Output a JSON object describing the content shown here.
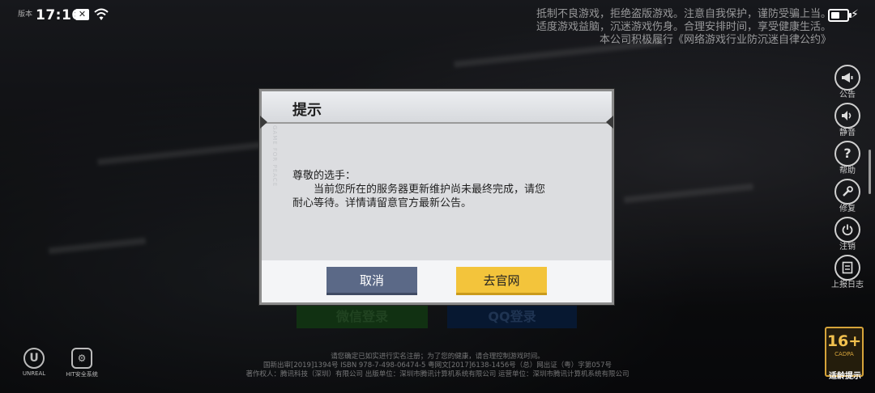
{
  "status_bar": {
    "version": "版本",
    "time": "17:16",
    "battery_level": 0.55
  },
  "notice": {
    "line1": "抵制不良游戏，拒绝盗版游戏。注意自我保护，谨防受骗上当。",
    "line2": "适度游戏益脑，沉迷游戏伤身。合理安排时间，享受健康生活。",
    "line3": "本公司积极履行《网络游戏行业防沉迷自律公约》"
  },
  "toolbar": {
    "items": [
      {
        "label": "公告",
        "icon": "megaphone-icon"
      },
      {
        "label": "静音",
        "icon": "speaker-icon"
      },
      {
        "label": "帮助",
        "icon": "help-icon"
      },
      {
        "label": "修复",
        "icon": "wrench-icon"
      },
      {
        "label": "注销",
        "icon": "power-icon"
      },
      {
        "label": "上报日志",
        "icon": "log-icon"
      }
    ]
  },
  "login": {
    "wechat_label": "微信登录",
    "qq_label": "QQ登录"
  },
  "dialog": {
    "title": "提示",
    "deco_text": "GAME FOR PEACE",
    "greeting": "尊敬的选手：",
    "message_line1": "当前您所在的服务器更新维护尚未最终完成，请您",
    "message_line2": "耐心等待。详情请留意官方最新公告。",
    "cancel_label": "取消",
    "confirm_label": "去官网"
  },
  "footer": {
    "line1": "请您确定已如实进行实名注册；为了您的健康，请合理控制游戏时间。",
    "line2": "国新出审[2019]1394号  ISBN 978-7-498-06474-5  粤网文[2017]6138-1456号（总）网出证（粤）字第057号",
    "line3": "著作权人：腾讯科技（深圳）有限公司   出版单位：深圳市腾讯计算机系统有限公司   运营单位：深圳市腾讯计算机系统有限公司"
  },
  "logos": {
    "unreal_label": "UNREAL",
    "hit_label": "HIT安全系统"
  },
  "age_rating": {
    "age": "16+",
    "sub": "CADPA",
    "label": "适龄提示"
  },
  "colors": {
    "cancel_button": "#5b6987",
    "confirm_button": "#f3c43b",
    "age_badge": "#d6a43a"
  }
}
